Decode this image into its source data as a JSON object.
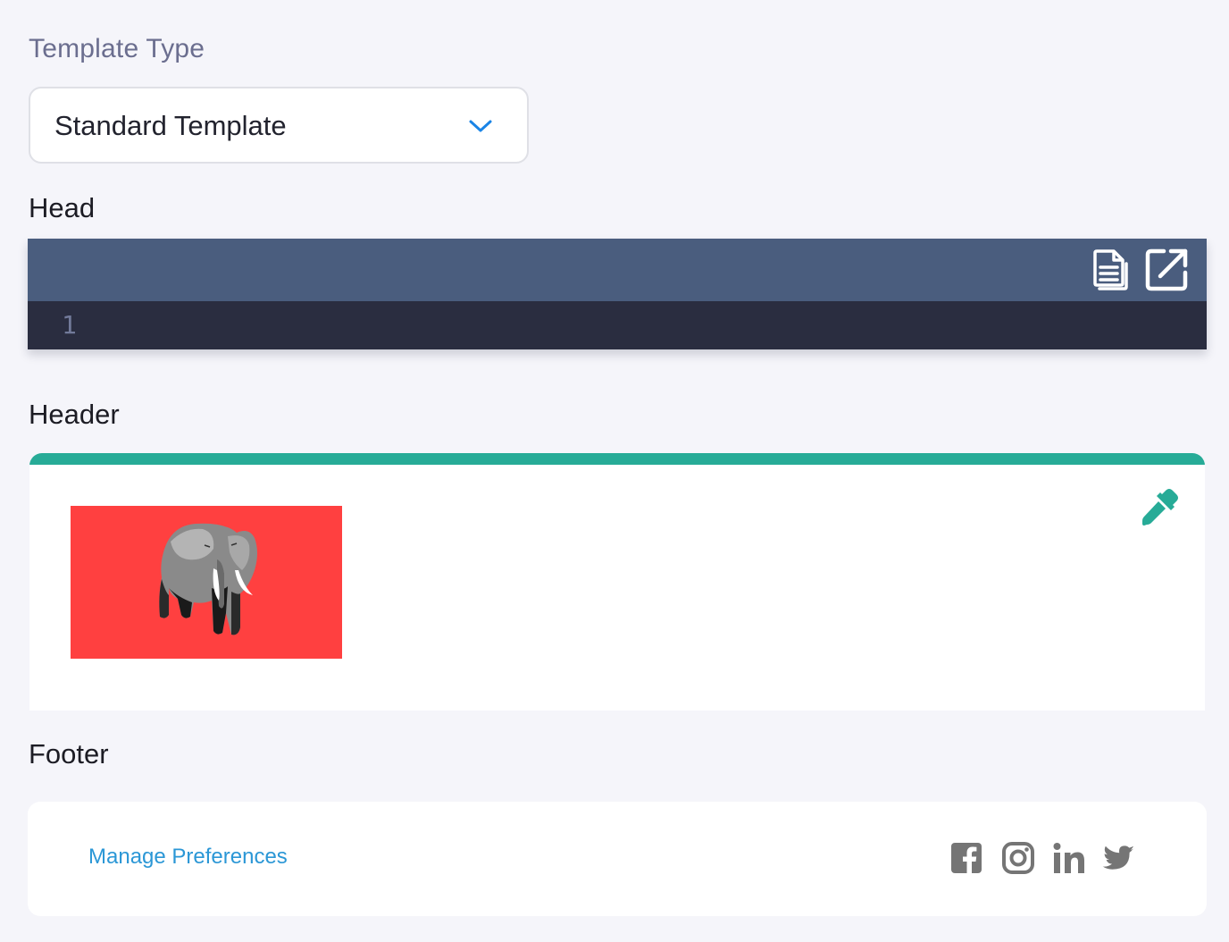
{
  "template_type": {
    "label": "Template Type",
    "selected": "Standard Template",
    "chevron_icon": "chevron-down-icon",
    "accent_color": "#1a84e6"
  },
  "head_section": {
    "title": "Head",
    "toolbar": {
      "copy_icon": "document-copy-icon",
      "expand_icon": "open-external-icon"
    },
    "line_numbers": [
      "1"
    ],
    "toolbar_color": "#4a5d7e",
    "editor_color": "#2a2d40"
  },
  "header_section": {
    "title": "Header",
    "accent_color": "#27ab97",
    "logo": {
      "icon": "elephant-logo-image",
      "background_color": "#ff4040"
    },
    "eyedropper_icon": "eyedropper-icon"
  },
  "footer_section": {
    "title": "Footer",
    "link_label": "Manage Preferences",
    "link_color": "#2b97d6",
    "social_icons": [
      "facebook-icon",
      "instagram-icon",
      "linkedin-icon",
      "twitter-icon"
    ],
    "icon_color": "#757575"
  }
}
